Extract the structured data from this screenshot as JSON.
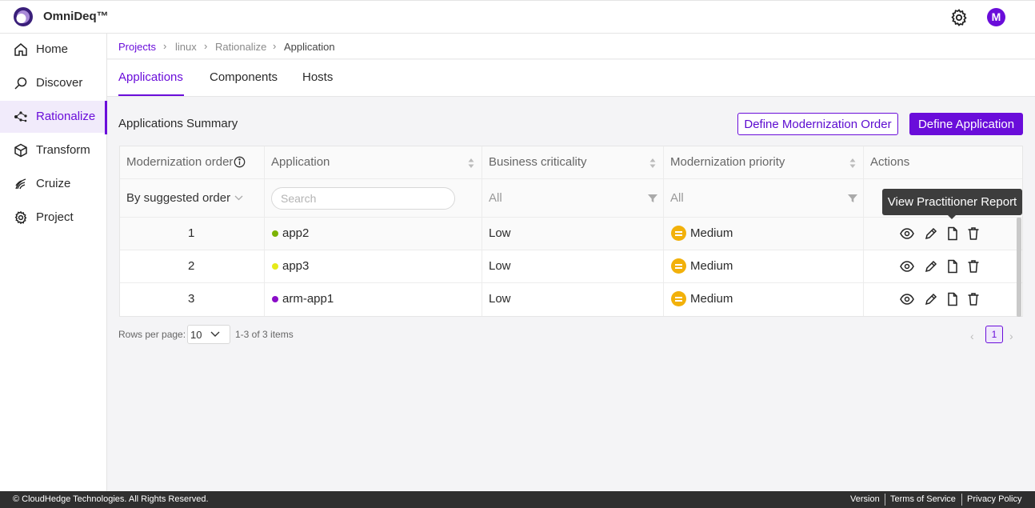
{
  "app": {
    "brand": "OmniDeq™",
    "avatar_initial": "M",
    "accent": "#6a0dda"
  },
  "sidebar": {
    "items": [
      {
        "label": "Home",
        "icon": "home-icon",
        "active": false
      },
      {
        "label": "Discover",
        "icon": "discover-icon",
        "active": false
      },
      {
        "label": "Rationalize",
        "icon": "rationalize-icon",
        "active": true
      },
      {
        "label": "Transform",
        "icon": "transform-icon",
        "active": false
      },
      {
        "label": "Cruize",
        "icon": "cruize-icon",
        "active": false
      },
      {
        "label": "Project",
        "icon": "project-gear-icon",
        "active": false
      }
    ]
  },
  "breadcrumb": [
    "Projects",
    "linux",
    "Rationalize",
    "Application"
  ],
  "tabs": [
    {
      "label": "Applications",
      "active": true
    },
    {
      "label": "Components",
      "active": false
    },
    {
      "label": "Hosts",
      "active": false
    }
  ],
  "summary": {
    "title": "Applications Summary",
    "define_order_button": "Define Modernization Order",
    "define_app_button": "Define Application"
  },
  "table": {
    "headers": [
      "Modernization order",
      "Application",
      "Business criticality",
      "Modernization priority",
      "Actions"
    ],
    "filters": {
      "order_select": "By suggested order",
      "search_placeholder": "Search",
      "criticality": "All",
      "priority": "All"
    },
    "rows": [
      {
        "order": "1",
        "application": "app2",
        "dot_color": "#7cb305",
        "criticality": "Low",
        "priority": "Medium"
      },
      {
        "order": "2",
        "application": "app3",
        "dot_color": "#e6ea1a",
        "criticality": "Low",
        "priority": "Medium"
      },
      {
        "order": "3",
        "application": "arm-app1",
        "dot_color": "#8a0dc8",
        "criticality": "Low",
        "priority": "Medium"
      }
    ],
    "tooltip": "View Practitioner Report"
  },
  "pagination": {
    "rows_per_page_label": "Rows per page:",
    "rows_per_page": "10",
    "range": "1-3 of 3 items",
    "current_page": "1"
  },
  "footer": {
    "copyright": "© CloudHedge Technologies. All Rights Reserved.",
    "links": [
      "Version",
      "Terms of Service",
      "Privacy Policy"
    ]
  }
}
